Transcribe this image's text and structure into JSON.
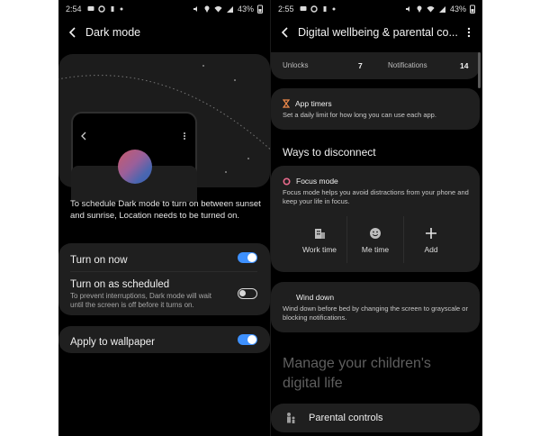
{
  "left": {
    "status": {
      "time": "2:54",
      "battery": "43%"
    },
    "title": "Dark mode",
    "description": "To schedule Dark mode to turn on between sunset and sunrise, Location needs to be turned on.",
    "settings": [
      {
        "label": "Turn on now",
        "sublabel": "",
        "on": true
      },
      {
        "label": "Turn on as scheduled",
        "sublabel": "To prevent interruptions, Dark mode will wait until the screen is off before it turns on.",
        "on": false
      },
      {
        "label": "Apply to wallpaper",
        "sublabel": "",
        "on": true
      }
    ],
    "icons": [
      "back-arrow-icon",
      "moon-icon",
      "more-vertical-icon"
    ]
  },
  "right": {
    "status": {
      "time": "2:55",
      "battery": "43%"
    },
    "title": "Digital wellbeing & parental co...",
    "stats": [
      {
        "label": "Unlocks",
        "value": "7"
      },
      {
        "label": "Notifications",
        "value": "14"
      }
    ],
    "app_timers": {
      "title": "App timers",
      "subtitle": "Set a daily limit for how long you can use each app."
    },
    "ways_header": "Ways to disconnect",
    "focus_mode": {
      "title": "Focus mode",
      "subtitle": "Focus mode helps you avoid distractions from your phone and keep your life in focus.",
      "actions": [
        {
          "label": "Work time",
          "icon": "building-icon"
        },
        {
          "label": "Me time",
          "icon": "smiley-icon"
        },
        {
          "label": "Add",
          "icon": "plus-icon"
        }
      ]
    },
    "wind_down": {
      "title": "Wind down",
      "subtitle": "Wind down before bed by changing the screen to grayscale or blocking notifications."
    },
    "children_heading": "Manage your children's digital life",
    "parental_controls": {
      "label": "Parental controls",
      "icon": "parental-controls-icon"
    }
  },
  "colors": {
    "toggle_on": "#3e91ff",
    "background": "#000000",
    "card": "#1f1f1f",
    "moon": "#f5c518",
    "timer_icon": "#f08a4b",
    "focus_icon": "#e86a8c",
    "wind_icon": "#8a74e8"
  }
}
